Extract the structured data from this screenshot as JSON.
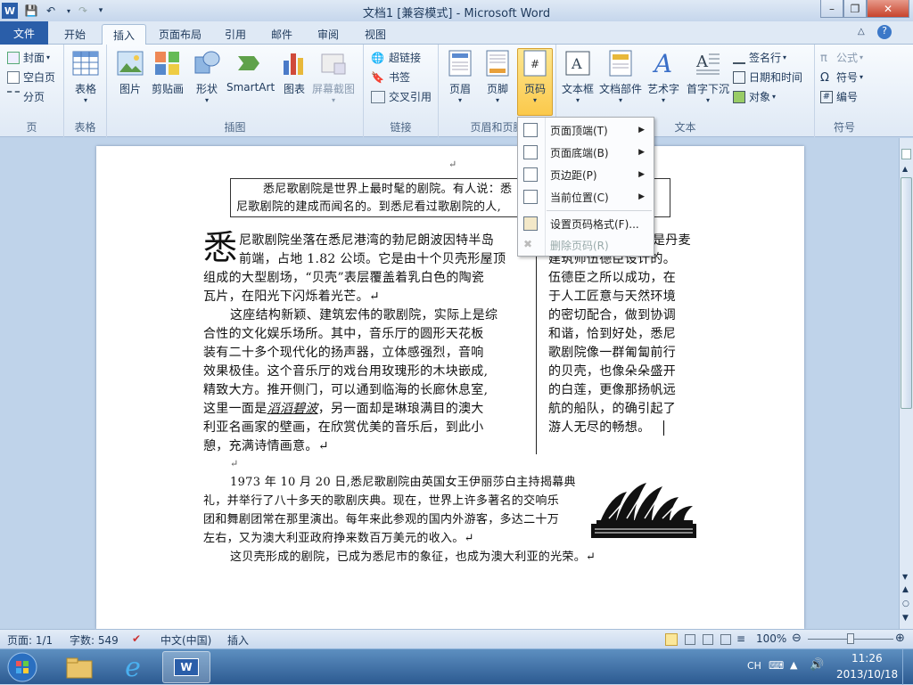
{
  "window": {
    "title": "文档1 [兼容模式] - Microsoft Word"
  },
  "tabs": [
    "文件",
    "开始",
    "插入",
    "页面布局",
    "引用",
    "邮件",
    "审阅",
    "视图"
  ],
  "ribbon": {
    "pages": {
      "items": [
        "封面",
        "空白页",
        "分页"
      ],
      "label": "页"
    },
    "tables": {
      "items": [
        "表格"
      ],
      "label": "表格"
    },
    "illustrations": {
      "items": [
        "图片",
        "剪贴画",
        "形状",
        "SmartArt",
        "图表",
        "屏幕截图"
      ],
      "label": "插图"
    },
    "links": {
      "items": [
        "超链接",
        "书签",
        "交叉引用"
      ],
      "label": "链接"
    },
    "header_footer": {
      "items": [
        "页眉",
        "页脚",
        "页码"
      ],
      "label": "页眉和页脚"
    },
    "text": {
      "items": [
        "文本框",
        "文档部件",
        "艺术字",
        "首字下沉"
      ],
      "right_items": [
        "签名行",
        "日期和时间",
        "对象"
      ],
      "label": "文本"
    },
    "symbols": {
      "items": [
        "公式",
        "符号",
        "编号"
      ],
      "label": "符号"
    }
  },
  "page_number_menu": {
    "items": [
      "页面顶端(T)",
      "页面底端(B)",
      "页边距(P)",
      "当前位置(C)"
    ],
    "format": "设置页码格式(F)...",
    "remove": "删除页码(R)"
  },
  "document": {
    "textbox_line1": "悉尼歌剧院是世界上最时髦的剧院。有人说：悉",
    "textbox_line2": "尼歌剧院的建成而闻名的。到悉尼看过歌剧院的人,",
    "dropcap": "悉",
    "col1": [
      "尼歌剧院坐落在悉尼港湾的勃尼朗波因特半岛",
      "前端，占地 1.82 公顷。它是由十个贝壳形屋顶",
      "组成的大型剧场，“贝壳”表层覆盖着乳白色的陶瓷",
      "瓦片，在阳光下闪烁着光芒。↵",
      "这座结构新颖、建筑宏伟的歌剧院，实际上是综",
      "合性的文化娱乐场所。其中，音乐厅的圆形天花板",
      "装有二十多个现代化的扬声器，立体感强烈，音响",
      "效果极佳。这个音乐厅的戏台用玫瑰形的木块嵌成,",
      "精致大方。推开侧门，可以通到临海的长廊休息室,",
      "这里一面是",
      "利亚名画家的壁画，在欣赏优美的音乐后，到此小",
      "憩，充满诗情画意。↵"
    ],
    "col1_line10_italic": "滔滔碧波",
    "col1_line10_rest": "，另一面却是琳琅满目的澳大",
    "col2": [
      "是丹麦",
      "建筑师伍德臣设计的。",
      "伍德臣之所以成功，在",
      "于人工匠意与天然环境",
      "的密切配合，做到协调",
      "和谐，恰到好处，悉尼",
      "歌剧院像一群匍匐前行",
      "的贝壳，也像朵朵盛开",
      "的白莲，更像那扬帆远",
      "航的船队，的确引起了",
      "游人无尽的畅想。"
    ],
    "para3": [
      "1973 年 10 月 20 日,悉尼歌剧院由英国女王伊丽莎白主持揭幕典",
      "礼，并举行了八十多天的歌剧庆典。现在，世界上许多著名的交响乐",
      "团和舞剧团常在那里演出。每年来此参观的国内外游客，多达二十万",
      "左右，又为澳大利亚政府挣来数百万美元的收入。↵"
    ],
    "para4": "这贝壳形成的剧院，已成为悉尼市的象征，也成为澳大利亚的光荣。↵"
  },
  "status": {
    "page": "页面: 1/1",
    "words": "字数: 549",
    "lang": "中文(中国)",
    "mode": "插入",
    "zoom": "100%"
  },
  "tray": {
    "ime": "CH",
    "time": "11:26",
    "date": "2013/10/18"
  },
  "colors": {
    "file_tab": "#2a5ea9",
    "highlight": "#fbc94b",
    "taskbar": "#2c5a91"
  }
}
